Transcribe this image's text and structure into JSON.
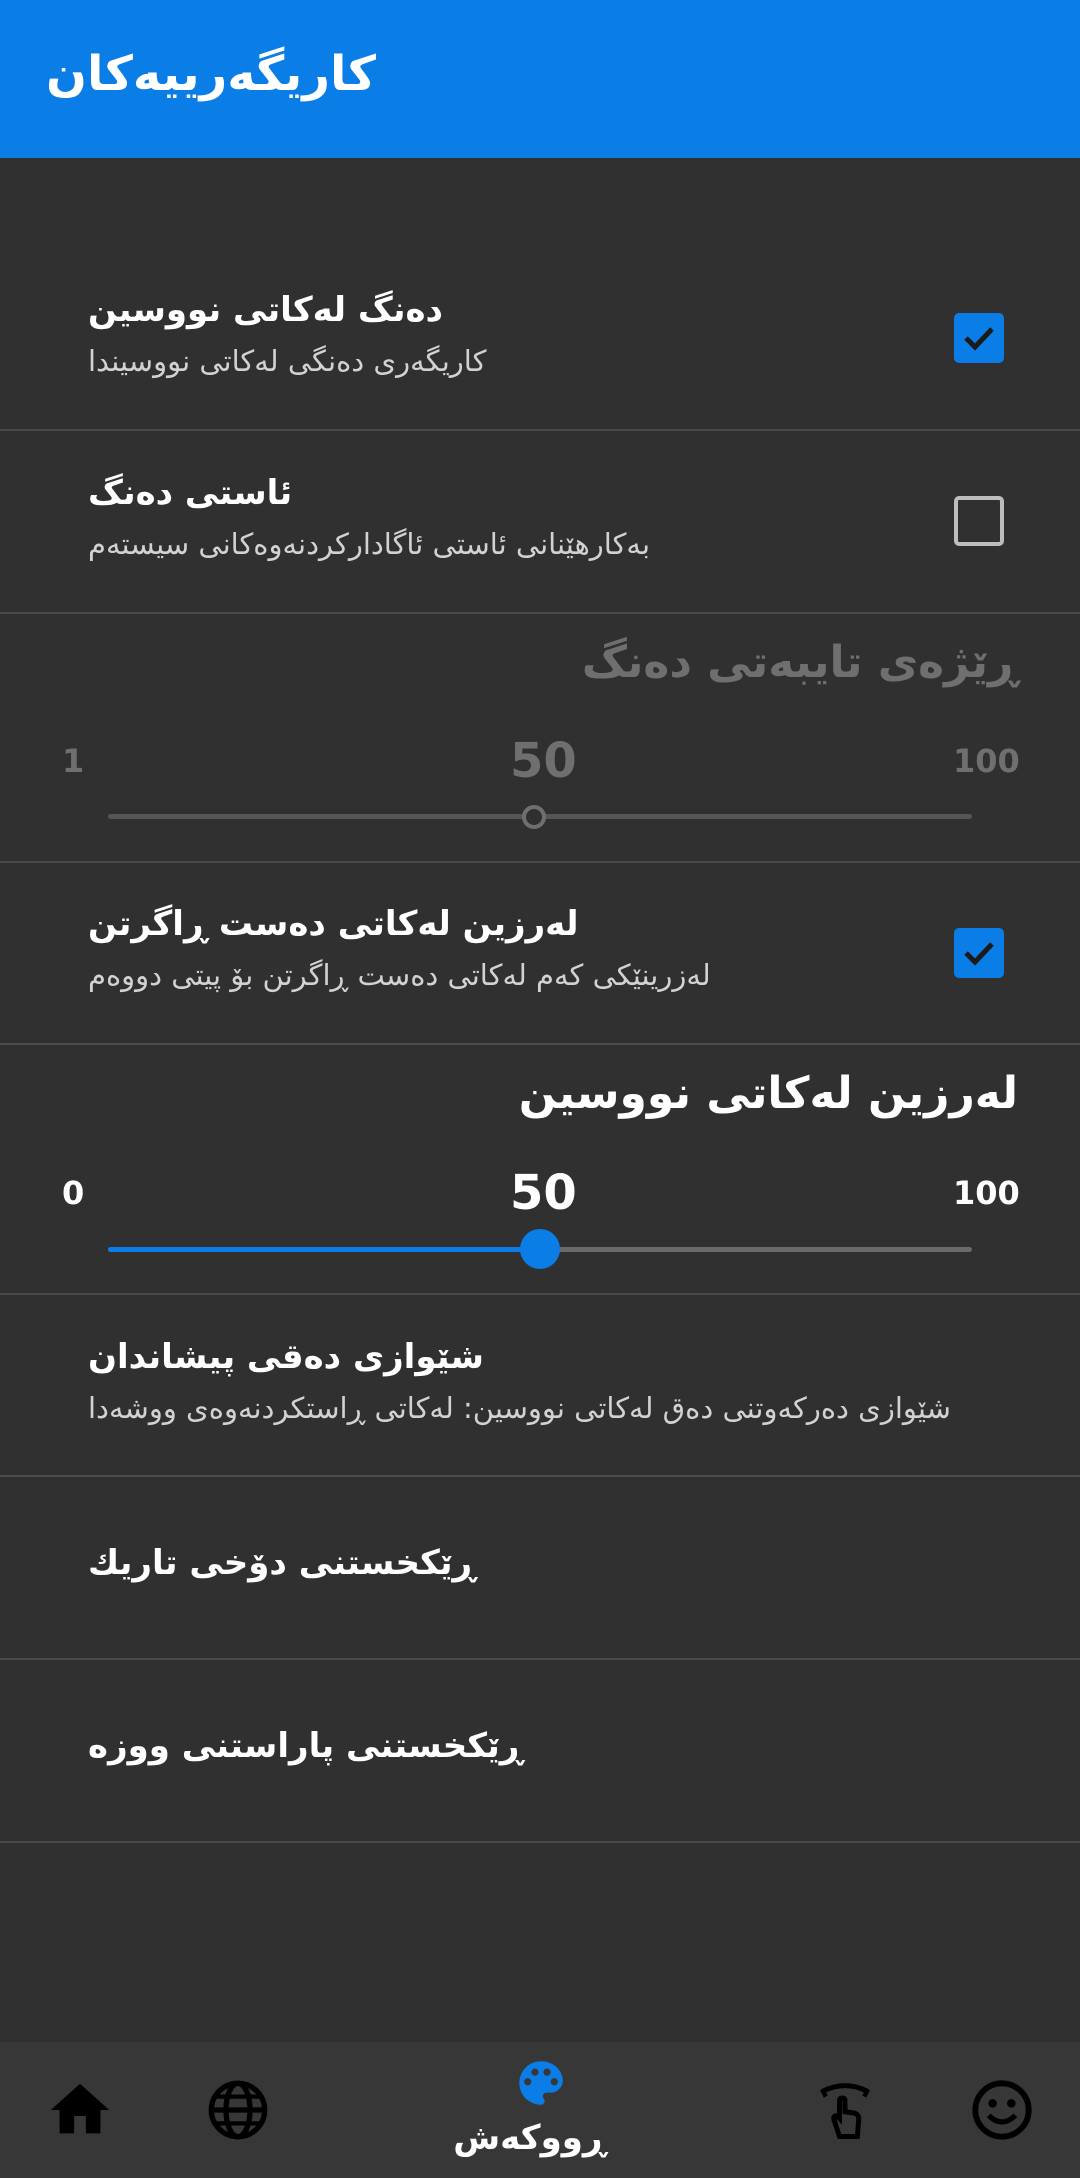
{
  "appbar": {
    "title": "كاریگەرییەكان"
  },
  "prefs": {
    "typing_sound": {
      "title": "دەنگ لەكاتی نووسین",
      "summary": "كاریگەری دەنگی لەكاتی نووسیندا",
      "checked": true
    },
    "sound_level": {
      "title": "ئاستی دەنگ",
      "summary": "بەكارهێنانی ئاستی ئاگاداركردنەوەكانی سیستەم",
      "checked": false
    },
    "custom_volume": {
      "title": "ڕێژەی تایبەتی دەنگ",
      "min": "1",
      "value": "50",
      "max": "100",
      "enabled": false
    },
    "longpress_vibe": {
      "title": "لەرزین لەكاتی دەست ڕاگرتن",
      "summary": "لەزرینێكی كەم لەكاتی دەست ڕاگرتن بۆ پیتی دووەم",
      "checked": true
    },
    "typing_vibe": {
      "title": "لەرزین لەكاتی نووسین",
      "min": "0",
      "value": "50",
      "max": "100",
      "enabled": true
    },
    "popup_style": {
      "title": "شێوازی دەقی پیشاندان",
      "summary": "شێوازی دەركەوتنی دەق لەكاتی نووسین: لەكاتی ڕاستكردنەوەی ووشەدا"
    },
    "dark_mode": {
      "title": "ڕێكخستنی دۆخی تاریك"
    },
    "word_protect": {
      "title": "ڕێكخستنی پاراستنی ووزە"
    }
  },
  "bottom_nav": {
    "items": [
      {
        "icon": "home-icon"
      },
      {
        "icon": "globe-icon"
      },
      {
        "icon": "palette-icon",
        "label": "ڕووكەش",
        "selected": true
      },
      {
        "icon": "touch-gesture-icon"
      },
      {
        "icon": "smiley-icon"
      }
    ]
  },
  "colors": {
    "accent": "#0a7ee6",
    "background": "#303030",
    "nav": "#373737",
    "divider": "#4a4a4a"
  }
}
